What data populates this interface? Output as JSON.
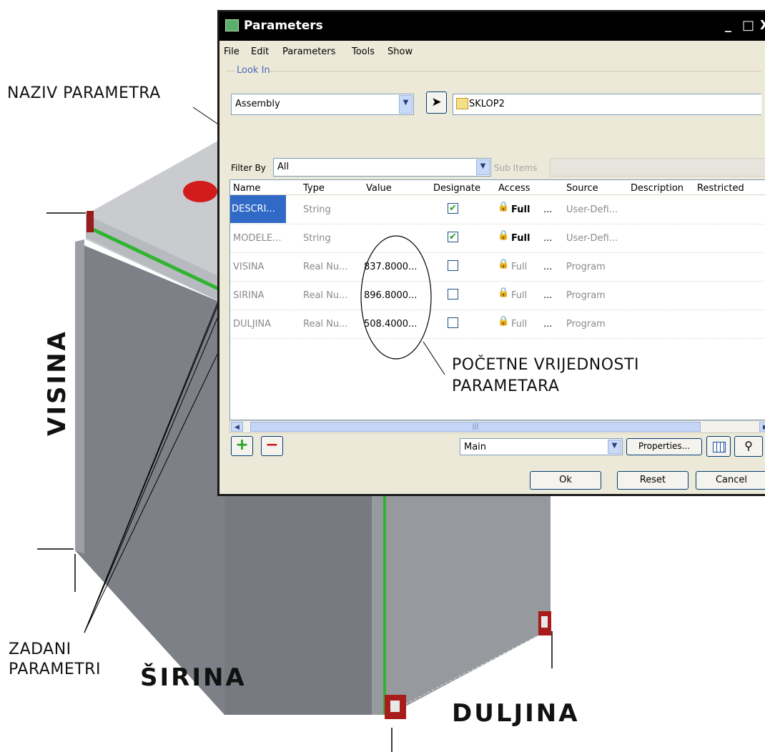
{
  "annotations": {
    "naziv_parametra": "NAZIV PARAMETRA",
    "pocetne_line1": "POČETNE VRIJEDNOSTI",
    "pocetne_line2": "PARAMETARA",
    "zadani_line1": "ZADANI",
    "zadani_line2": "PARAMETRI",
    "visina": "VISINA",
    "sirina": "ŠIRINA",
    "duljina": "DULJINA"
  },
  "dialog": {
    "title": "Parameters",
    "window_buttons": {
      "minimize": "_",
      "maximize": "□",
      "close": "X"
    },
    "menu": [
      "File",
      "Edit",
      "Parameters",
      "Tools",
      "Show"
    ],
    "look_in": {
      "label": "Look In",
      "type_value": "Assembly",
      "object_value": "SKLOP2"
    },
    "filter": {
      "label": "Filter By",
      "value": "All",
      "sub_items_label": "Sub Items",
      "sub_items_value": ""
    },
    "columns": [
      "Name",
      "Type",
      "Value",
      "Designate",
      "Access",
      "Source",
      "Description",
      "Restricted"
    ],
    "rows": [
      {
        "name": "DESCRI...",
        "type": "String",
        "value": "",
        "designate": "✔",
        "access": "Full",
        "ellipsis": "...",
        "source": "User-Defi..."
      },
      {
        "name": "MODELE...",
        "type": "String",
        "value": "",
        "designate": "✔",
        "access": "Full",
        "ellipsis": "...",
        "source": "User-Defi..."
      },
      {
        "name": "VISINA",
        "type": "Real Nu...",
        "value": "837.8000...",
        "designate": "",
        "access": "Full",
        "ellipsis": "...",
        "source": "Program"
      },
      {
        "name": "SIRINA",
        "type": "Real Nu...",
        "value": "896.8000...",
        "designate": "",
        "access": "Full",
        "ellipsis": "...",
        "source": "Program"
      },
      {
        "name": "DULJINA",
        "type": "Real Nu...",
        "value": "508.4000...",
        "designate": "",
        "access": "Full",
        "ellipsis": "...",
        "source": "Program"
      }
    ],
    "bottom": {
      "add": "+",
      "remove": "−",
      "view_value": "Main",
      "properties": "Properties..."
    },
    "footer": {
      "ok": "Ok",
      "reset": "Reset",
      "cancel": "Cancel"
    },
    "colors": {
      "titlebar": "#000000",
      "selection": "#3169c6",
      "window_bg": "#ece9d8",
      "accent_label": "#4a6cc0"
    }
  },
  "icons": [
    "parameters-app-icon",
    "arrow-pointer-icon",
    "assembly-folder-icon",
    "lock-icon",
    "columns-icon",
    "binoculars-icon"
  ]
}
